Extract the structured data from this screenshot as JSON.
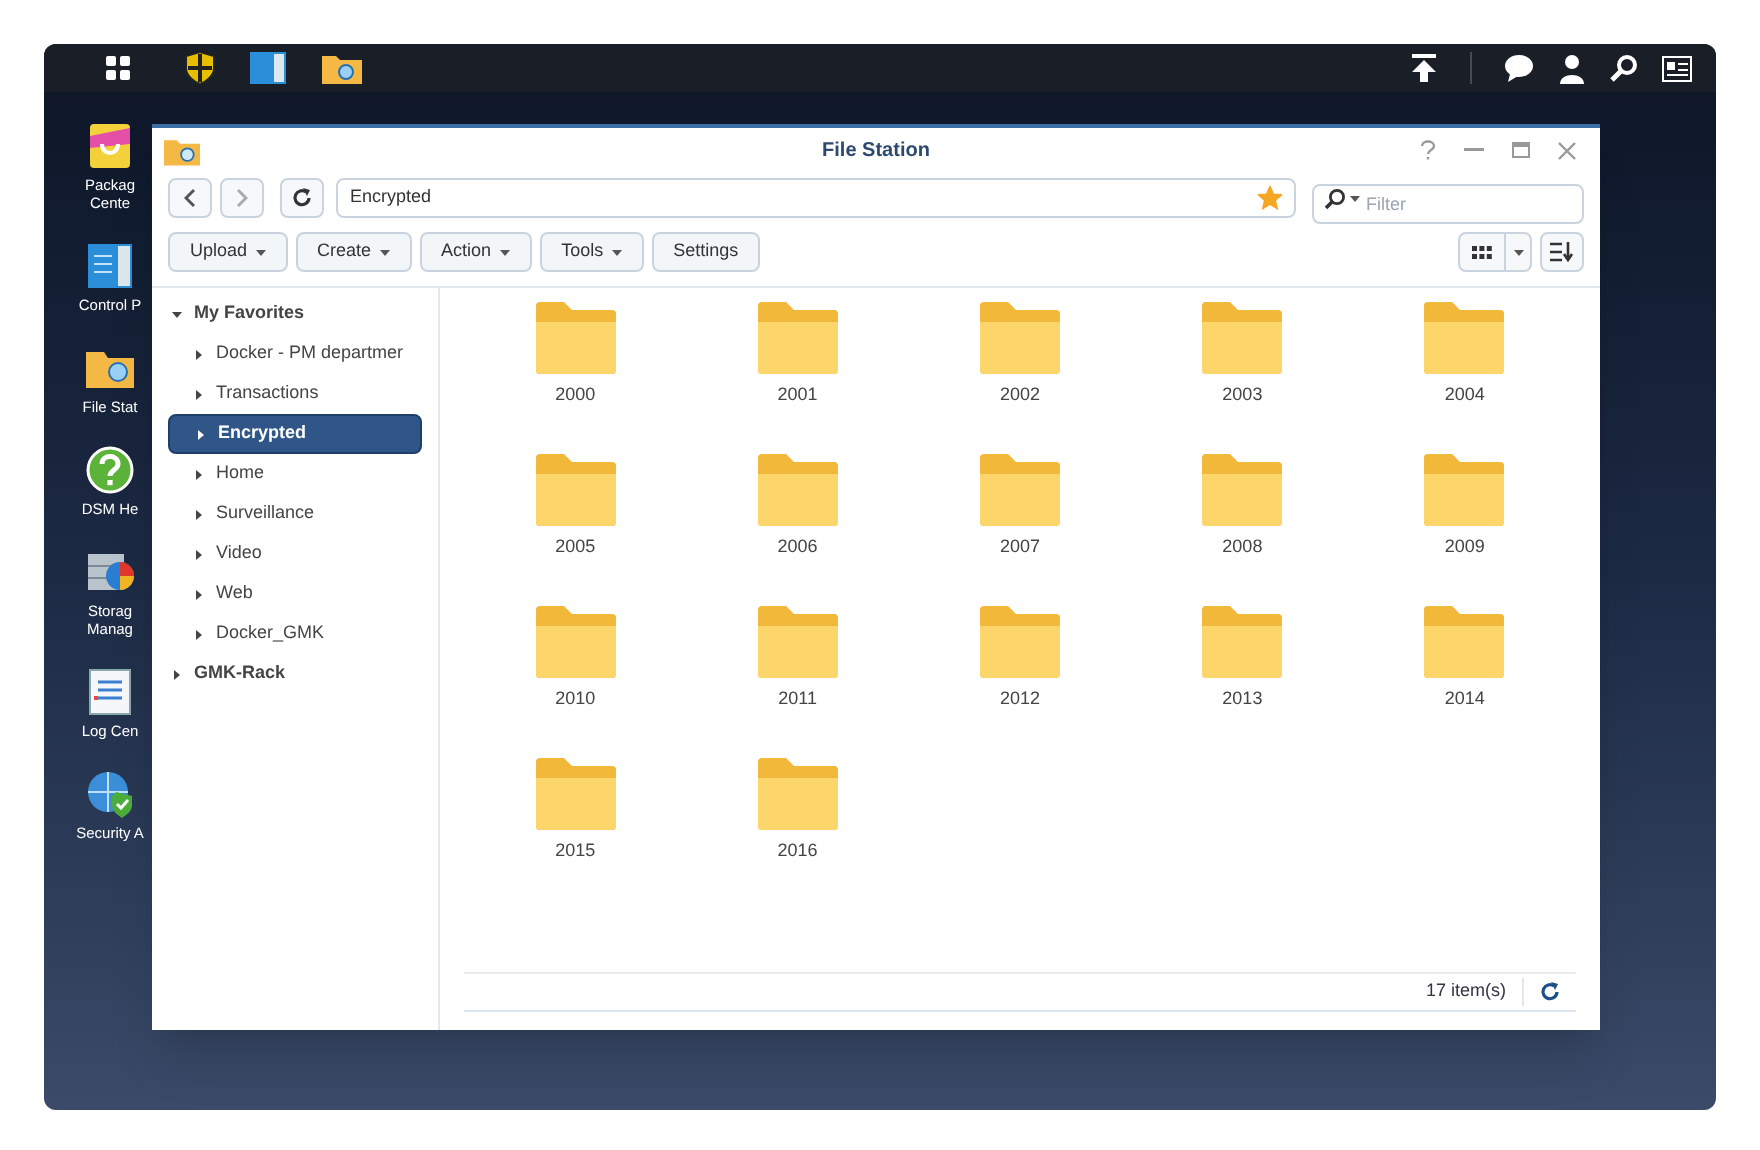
{
  "desktop_icons": [
    {
      "kind": "package",
      "lines": [
        "Packag",
        "Cente"
      ]
    },
    {
      "kind": "control",
      "lines": [
        "Control P"
      ]
    },
    {
      "kind": "files",
      "lines": [
        "File Stat"
      ]
    },
    {
      "kind": "help",
      "lines": [
        "DSM He"
      ]
    },
    {
      "kind": "storage",
      "lines": [
        "Storag",
        "Manag"
      ]
    },
    {
      "kind": "log",
      "lines": [
        "Log Cen"
      ]
    },
    {
      "kind": "security",
      "lines": [
        "Security A"
      ]
    }
  ],
  "window": {
    "title": "File Station",
    "address": "Encrypted",
    "starred": true,
    "filter": {
      "placeholder": "Filter"
    },
    "toolbar": [
      {
        "label": "Upload",
        "dropdown": true
      },
      {
        "label": "Create",
        "dropdown": true
      },
      {
        "label": "Action",
        "dropdown": true
      },
      {
        "label": "Tools",
        "dropdown": true
      },
      {
        "label": "Settings",
        "dropdown": false
      }
    ],
    "sidebar": [
      {
        "label": "My Favorites",
        "expanded": true,
        "selected": false,
        "children": [
          {
            "label": "Docker - PM departmer",
            "selected": false
          },
          {
            "label": "Transactions",
            "selected": false
          },
          {
            "label": "Encrypted",
            "selected": true
          },
          {
            "label": "Home",
            "selected": false
          },
          {
            "label": "Surveillance",
            "selected": false
          },
          {
            "label": "Video",
            "selected": false
          },
          {
            "label": "Web",
            "selected": false
          },
          {
            "label": "Docker_GMK",
            "selected": false
          }
        ]
      },
      {
        "label": "GMK-Rack",
        "expanded": false,
        "selected": false
      }
    ],
    "folders": [
      "2000",
      "2001",
      "2002",
      "2003",
      "2004",
      "2005",
      "2006",
      "2007",
      "2008",
      "2009",
      "2010",
      "2011",
      "2012",
      "2013",
      "2014",
      "2015",
      "2016"
    ],
    "status": "17 item(s)"
  }
}
